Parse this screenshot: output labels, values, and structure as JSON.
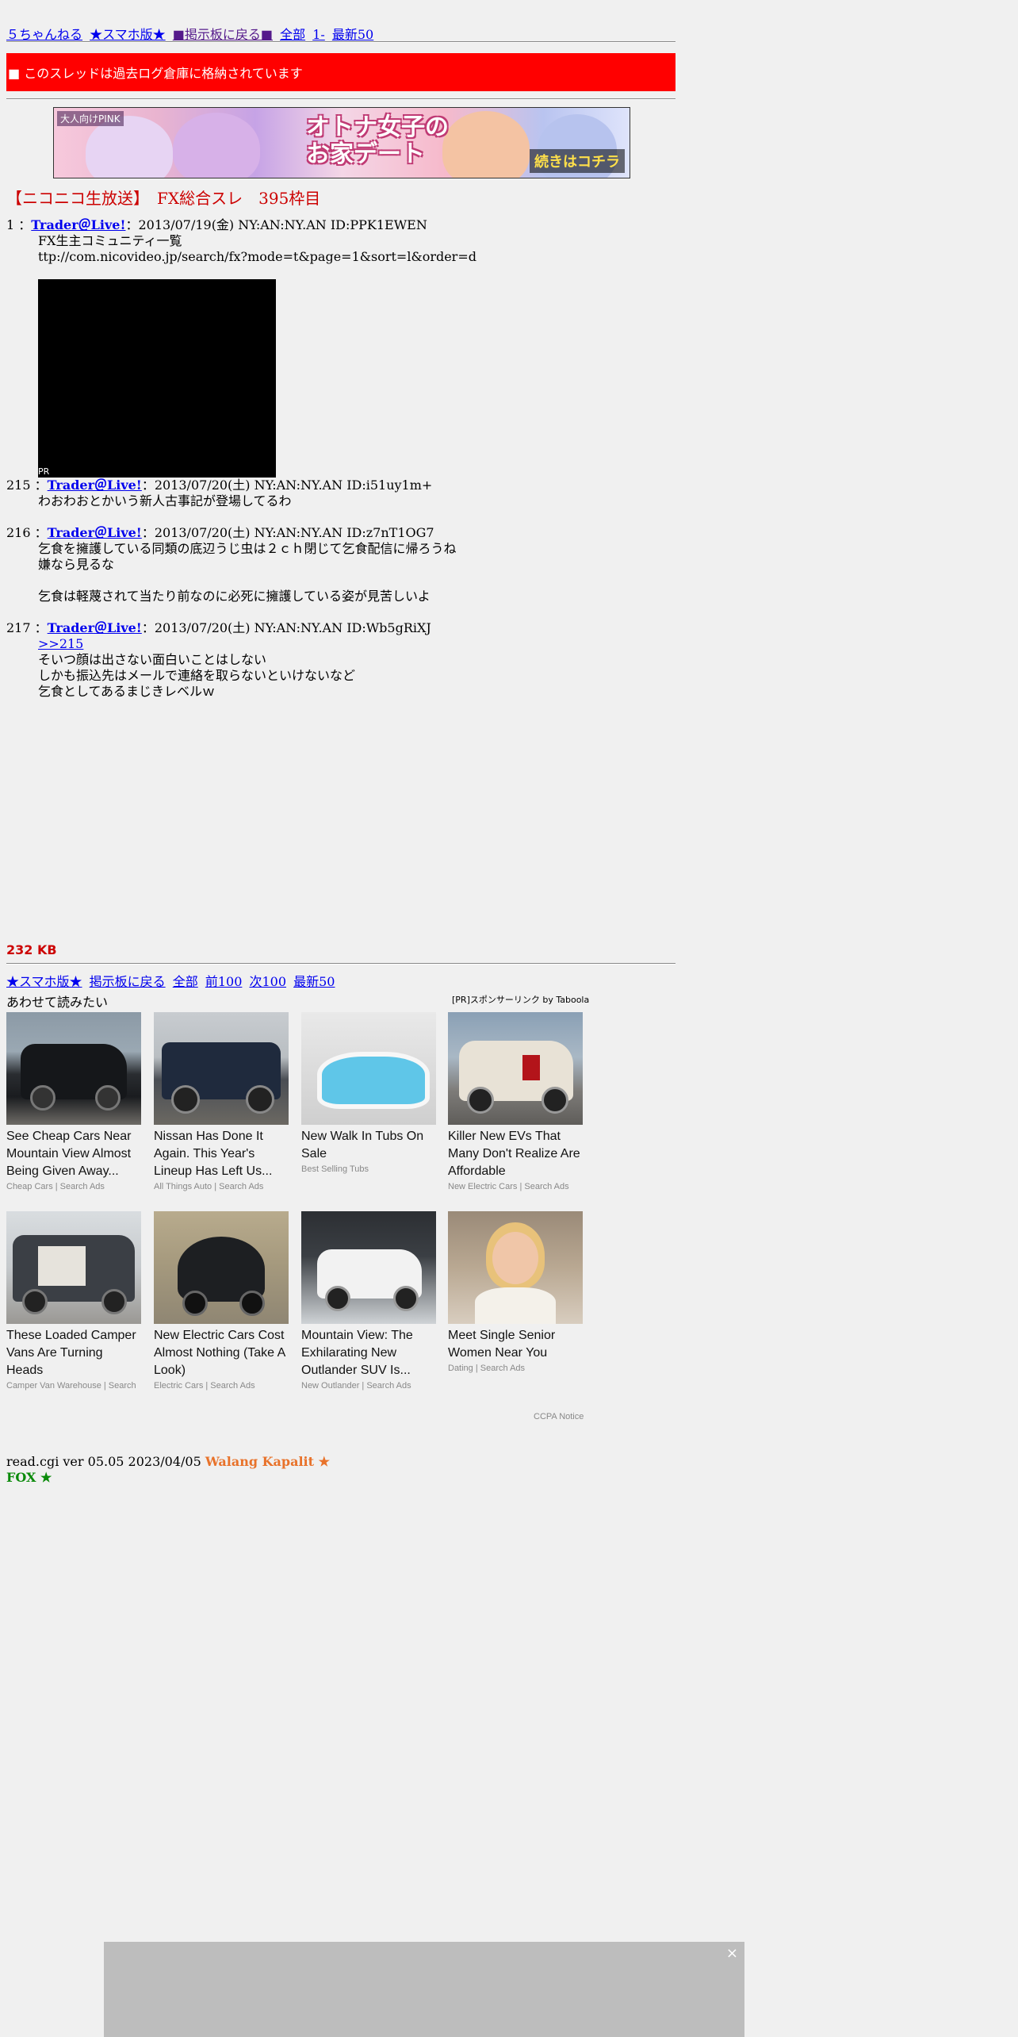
{
  "topnav": {
    "items": [
      "５ちゃんねる",
      "★スマホ版★",
      "■掲示板に戻る■",
      "全部",
      "1-",
      "最新50"
    ]
  },
  "archive_notice": "■ このスレッドは過去ログ倉庫に格納されています",
  "banner": {
    "logo_text": "大人向けPINK",
    "main_text_line1": "オトナ女子の",
    "main_text_line2": "お家デート",
    "cta": "続きはコチラ"
  },
  "thread_title": "【ニコニコ生放送】　FX総合スレ　395枠目",
  "posts": [
    {
      "num": "1",
      "sep": "：",
      "name": "Trader＠Live!",
      "meta": "：2013/07/19(金) NY:AN:NY.AN ID:PPK1EWEN",
      "lines": [
        "FX生主コミュニティ一覧",
        "ttp://com.nicovideo.jp/search/fx?mode=t&page=1&sort=l&order=d"
      ]
    },
    {
      "num": "215",
      "sep": "：",
      "name": "Trader＠Live!",
      "meta": "：2013/07/20(土) NY:AN:NY.AN ID:i51uy1m+",
      "lines": [
        "わおわおとかいう新人古事記が登場してるわ"
      ]
    },
    {
      "num": "216",
      "sep": "：",
      "name": "Trader＠Live!",
      "meta": "：2013/07/20(土) NY:AN:NY.AN ID:z7nT1OG7",
      "lines": [
        "乞食を擁護している同類の底辺うじ虫は２ｃｈ閉じて乞食配信に帰ろうね",
        "嫌なら見るな",
        "",
        "乞食は軽蔑されて当たり前なのに必死に擁護している姿が見苦しいよ"
      ]
    },
    {
      "num": "217",
      "sep": "：",
      "name": "Trader＠Live!",
      "meta": "：2013/07/20(土) NY:AN:NY.AN ID:Wb5gRiXJ",
      "reply": ">>215",
      "lines": [
        "そいつ顔は出さない面白いことはしない",
        "しかも振込先はメールで連絡を取らないといけないなど",
        "乞食としてあるまじきレベルｗ"
      ]
    }
  ],
  "pr_label": "PR",
  "size": "232 KB",
  "bottomnav": {
    "items": [
      "★スマホ版★",
      "掲示板に戻る",
      "全部",
      "前100",
      "次100",
      "最新50"
    ]
  },
  "recommend": {
    "title": "あわせて読みたい",
    "sponsor": "[PR]スポンサーリンク by Taboola",
    "cards": [
      {
        "title": "See Cheap Cars Near Mountain View Almost Being Given Away...",
        "source": "Cheap Cars | Search Ads",
        "thumb": "dark-suv-photo"
      },
      {
        "title": "Nissan Has Done It Again. This Year's Lineup Has Left Us...",
        "source": "All Things Auto | Search Ads",
        "thumb": "pickup-truck-photo"
      },
      {
        "title": "New Walk In Tubs On Sale",
        "source": "Best Selling Tubs",
        "thumb": "bathtub-photo"
      },
      {
        "title": "Killer New EVs That Many Don't Realize Are Affordable",
        "source": "New Electric Cars | Search Ads",
        "thumb": "white-suv-photo"
      },
      {
        "title": "These Loaded Camper Vans Are Turning Heads",
        "source": "Camper Van Warehouse | Search",
        "thumb": "camper-van-photo"
      },
      {
        "title": "New Electric Cars Cost Almost Nothing (Take A Look)",
        "source": "Electric Cars | Search Ads",
        "thumb": "mini-ev-photo"
      },
      {
        "title": "Mountain View: The Exhilarating New Outlander SUV Is...",
        "source": "New Outlander | Search Ads",
        "thumb": "outlander-photo"
      },
      {
        "title": "Meet Single Senior Women Near You",
        "source": "Dating | Search Ads",
        "thumb": "woman-portrait-photo"
      }
    ],
    "ccpa": "CCPA Notice"
  },
  "footer": {
    "version": "read.cgi ver 05.05 2023/04/05",
    "kapalit": "Walang Kapalit ★",
    "fox": "FOX ★"
  },
  "adbar_close": "×"
}
